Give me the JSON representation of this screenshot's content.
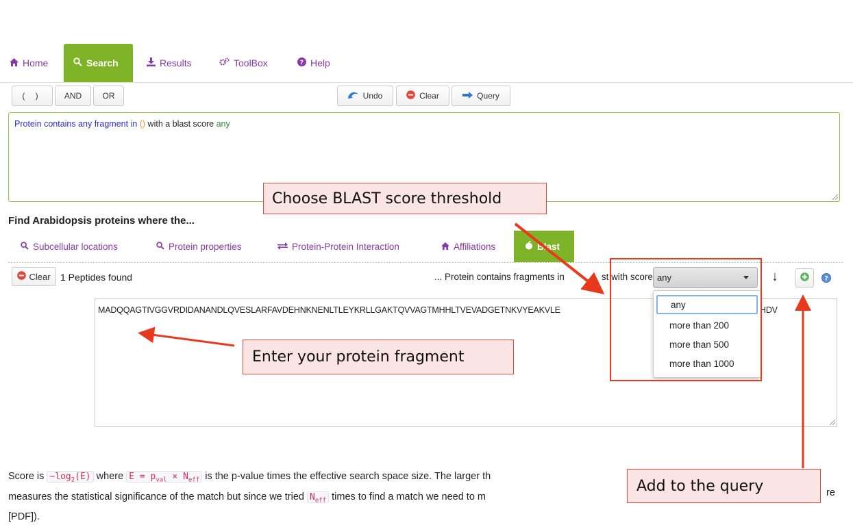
{
  "nav": {
    "tabs": [
      {
        "label": "Home",
        "icon": "home-icon"
      },
      {
        "label": "Search",
        "icon": "search-icon"
      },
      {
        "label": "Results",
        "icon": "download-icon"
      },
      {
        "label": "ToolBox",
        "icon": "gears-icon"
      },
      {
        "label": "Help",
        "icon": "help-icon"
      }
    ]
  },
  "toolbar": {
    "paren_label": "( )",
    "and_label": "AND",
    "or_label": "OR",
    "undo_label": "Undo",
    "clear_label": "Clear",
    "query_label": "Query"
  },
  "query": {
    "part1": "Protein contains any fragment in ",
    "part2": "()",
    "part3": " with a blast score ",
    "part4": "any"
  },
  "section": {
    "title": "Find Arabidopsis proteins where the...",
    "tabs": [
      {
        "label": "Subcellular locations"
      },
      {
        "label": "Protein properties"
      },
      {
        "label": "Protein-Protein Interaction"
      },
      {
        "label": "Affiliations"
      },
      {
        "label": "Blast"
      }
    ]
  },
  "blast": {
    "clear_label": "Clear",
    "found_text": "1 Peptides found",
    "desc_text": "... Protein contains fragments in",
    "desc_text2": "st with score",
    "selected": "any",
    "options": [
      "any",
      "more than 200",
      "more than 500",
      "more than 1000"
    ],
    "fragment_left": "MADQQAGTIVGGVRDIDANANDLQVESLARFAVDEHNKNENLTLEYKRLLGAKTQVVAGTMHHLTVEVADGETNKVYEAKVLE",
    "fragment_right": "HDV",
    "down_arrow": "↓"
  },
  "callouts": {
    "score": "Choose BLAST score threshold",
    "fragment": "Enter your protein fragment",
    "add": "Add to the query"
  },
  "bottom": {
    "t1": "Score is ",
    "c1": "−log₂(E)",
    "t2": " where ",
    "c2": "E = p_val × N_eff",
    "t3": " is the p-value times the effective search space size. The larger th",
    "t4": "measures the statistical significance of the match but since we tried ",
    "c3": "N_eff",
    "t5": " times to find a match we need to m",
    "t6": "re",
    "t7": "[PDF])."
  },
  "colors": {
    "accent": "#7fb327",
    "link": "#8a3aa6",
    "callout_border": "#e04a3a",
    "callout_bg": "#fbe4e4"
  }
}
